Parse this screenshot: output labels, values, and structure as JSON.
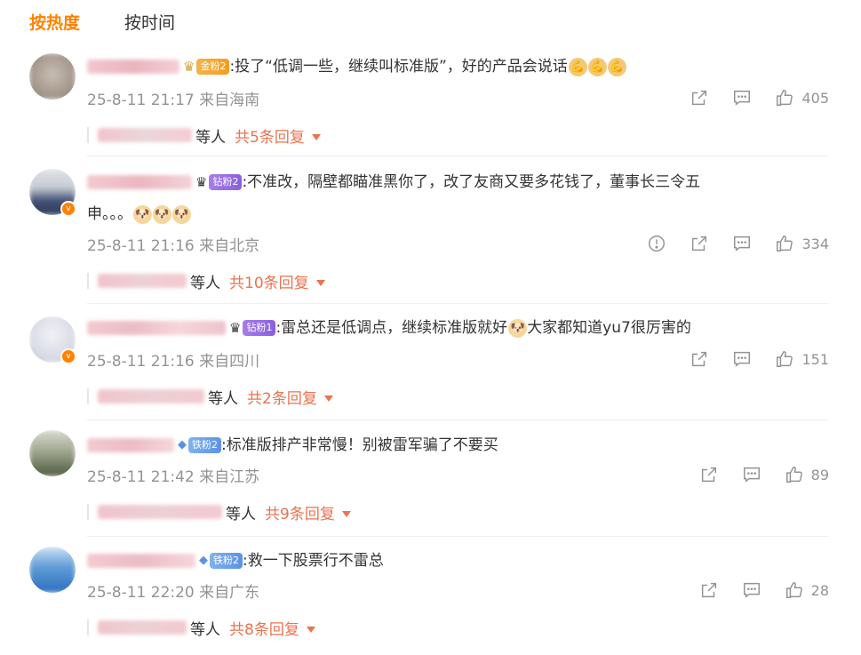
{
  "tabs": {
    "hot": "按热度",
    "time": "按时间"
  },
  "comments": [
    {
      "badge": "金粉2",
      "text": ":投了“低调一些，继续叫标准版”，好的产品会说话",
      "emojis": [
        "💪",
        "💪",
        "💪"
      ],
      "time": "25-8-11 21:17 来自海南",
      "likes": "405",
      "deng": "等人",
      "replies": "共5条回复"
    },
    {
      "badge": "钻粉2",
      "text_line1": ":不准改，隔壁都瞄准黑你了，改了友商又要多花钱了，董事长三令五",
      "text_line2": "申。。。",
      "emojis": [
        "🐶",
        "🐶",
        "🐶"
      ],
      "time": "25-8-11 21:16 来自北京",
      "likes": "334",
      "deng": "等人",
      "replies": "共10条回复"
    },
    {
      "badge": "钻粉1",
      "text_a": ":雷总还是低调点，继续标准版就好",
      "emoji": "🐶",
      "text_b": "大家都知道yu7很厉害的",
      "time": "25-8-11 21:16 来自四川",
      "likes": "151",
      "deng": "等人",
      "replies": "共2条回复"
    },
    {
      "badge": "铁粉2",
      "text": ":标准版排产非常慢！别被雷军骗了不要买",
      "time": "25-8-11 21:42 来自江苏",
      "likes": "89",
      "deng": "等人",
      "replies": "共9条回复"
    },
    {
      "badge": "铁粉2",
      "text": ":救一下股票行不雷总",
      "time": "25-8-11 22:20 来自广东",
      "likes": "28",
      "deng": "等人",
      "replies": "共8条回复"
    }
  ],
  "icons": {
    "share": "share-icon",
    "comment": "comment-icon",
    "like": "thumbs-up-icon",
    "report": "report-icon"
  },
  "colors": {
    "accent": "#ff8200",
    "reply_link": "#eb7350",
    "meta": "#939393"
  }
}
